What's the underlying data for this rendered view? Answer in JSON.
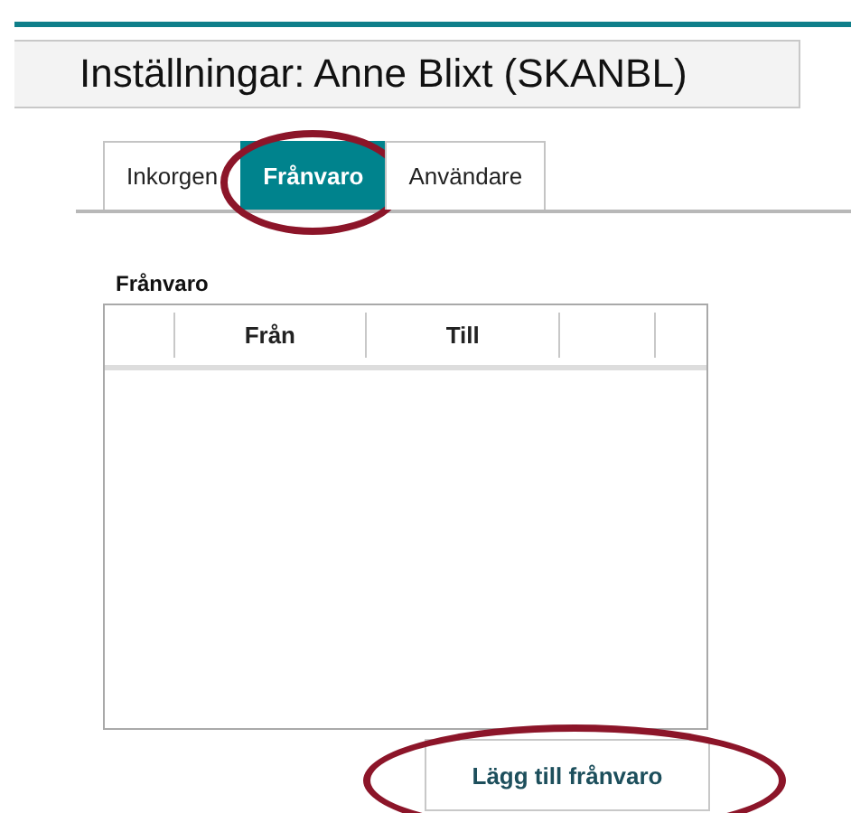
{
  "title": "Inställningar: Anne Blixt (SKANBL)",
  "tabs": [
    {
      "label": "Inkorgen",
      "selected": false,
      "circled": false
    },
    {
      "label": "Frånvaro",
      "selected": true,
      "circled": true
    },
    {
      "label": "Användare",
      "selected": false,
      "circled": false
    }
  ],
  "section": {
    "heading": "Frånvaro",
    "table": {
      "columns": [
        {
          "kind": "blank"
        },
        {
          "kind": "text",
          "label": "Från"
        },
        {
          "kind": "text",
          "label": "Till"
        },
        {
          "kind": "blank"
        },
        {
          "kind": "blank"
        }
      ]
    }
  },
  "button": {
    "label": "Lägg till frånvaro",
    "circled": true
  }
}
